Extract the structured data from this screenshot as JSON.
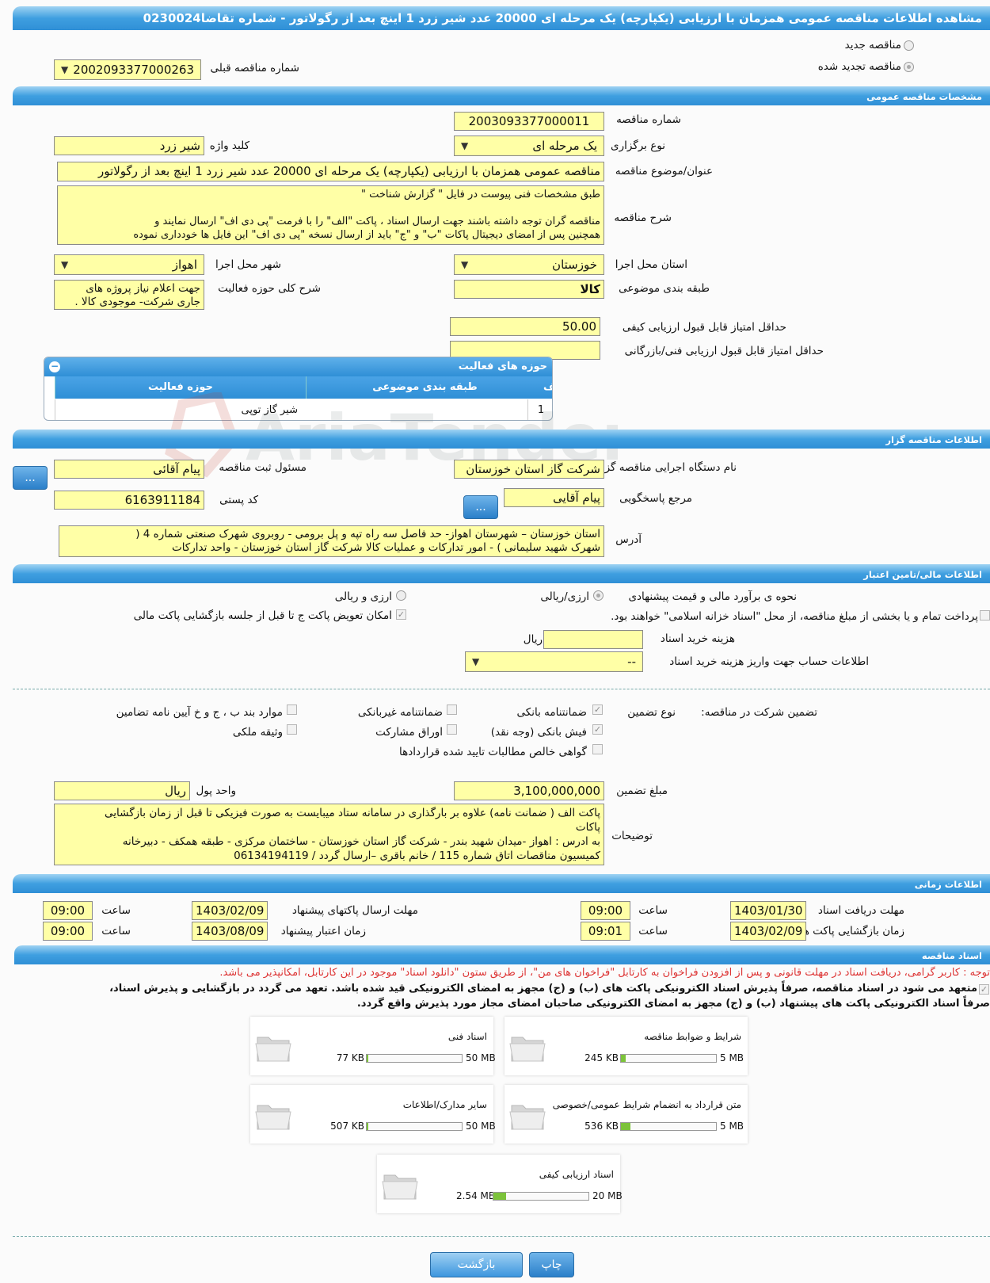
{
  "page_title": "مشاهده اطلاعات مناقصه عمومی همزمان با ارزیابی (یکپارچه) یک مرحله ای 20000 عدد شیر زرد 1 اینچ بعد از رگولاتور - شماره تقاضا0230024",
  "tender_type": {
    "new_label": "مناقصه جدید",
    "renewed_label": "مناقصه تجدید شده",
    "selected": "renewed",
    "prev_label": "شماره مناقصه قبلی",
    "prev_value": "2002093377000263"
  },
  "general": {
    "section_title": "مشخصات مناقصه عمومی",
    "number_label": "شماره مناقصه",
    "number": "2003093377000011",
    "method_label": "نوع برگزاری",
    "method": "یک مرحله ای",
    "keyword_label": "کلید واژه",
    "keyword": "شیر زرد",
    "subject_label": "عنوان/موضوع مناقصه",
    "subject": "مناقصه عمومی همزمان با ارزیابی (یکپارچه) یک مرحله ای 20000 عدد شیر زرد 1 اینچ بعد از رگولاتور",
    "desc_label": "شرح مناقصه",
    "desc_lines": [
      "طبق مشخصات فنی پیوست در فایل  \" گزارش شناخت \"",
      "",
      "مناقصه گران توجه داشته باشند جهت ارسال اسناد ، پاکت \"الف\" را با فرمت  \"پی دی اف\"  ارسال نمایند و",
      "همچنین پس از امضای دیجیتال پاکات  \"ب\" و \"ج\" باید از ارسال نسخه \"پی دی اف\"  این فایل ها خودداری نموده"
    ],
    "province_label": "استان محل اجرا",
    "province": "خوزستان",
    "city_label": "شهر محل اجرا",
    "city": "اهواز",
    "category_label": "طبقه بندی موضوعی",
    "category": "کالا",
    "activity_desc_label": "شرح کلی حوزه فعالیت",
    "activity_desc_lines": [
      "جهت اعلام نیاز پروژه های",
      "جاری شرکت- موجودی کالا ."
    ],
    "min_quality_label": "حداقل امتیاز قابل قبول ارزیابی کیفی",
    "min_quality": "50.00",
    "min_tech_label": "حداقل امتیاز قابل قبول ارزیابی فنی/بازرگانی",
    "min_tech": "",
    "activity_grid": {
      "title": "حوزه های فعالیت",
      "columns": [
        "ردیف",
        "طبقه بندی موضوعی",
        "حوزه فعالیت"
      ],
      "rows": [
        {
          "row": "1",
          "category": "شیر گاز توپی",
          "field": ""
        }
      ]
    }
  },
  "organizer": {
    "section_title": "اطلاعات مناقصه گزار",
    "org_label": "نام دستگاه اجرایی مناقصه گزار",
    "org": "شرکت گاز استان خوزستان",
    "registrar_label": "مسئول ثبت مناقصه",
    "registrar": "پیام  آقائی",
    "responder_label": "مرجع پاسخگویی",
    "responder": "پیام آقایی",
    "postal_label": "کد پستی",
    "postal": "6163911184",
    "address_label": "آدرس",
    "address_lines": [
      "استان خوزستان – شهرستان اهواز- حد فاصل سه راه تپه  و پل برومی - روبروی شهرک صنعتی شماره 4 (",
      "شهرک شهید سلیمانی  ) - امور تدارکات و عملیات کالا شرکت گاز استان خوزستان - واحد تدارکات"
    ],
    "more_btn": "..."
  },
  "finance": {
    "section_title": "اطلاعات مالی/تامین اعتبار",
    "estimate_label": "نحوه ی برآورد مالی و قیمت پیشنهادی",
    "opt_rial": "ارزی/ریالی",
    "opt_fx": "ارزی و ریالی",
    "treasury_label": "پرداخت تمام و یا بخشی از مبلغ مناقصه، از محل \"اسناد خزانه اسلامی\" خواهند بود.",
    "swap_label": "امکان تعویض پاکت ج تا قبل از جلسه بازگشایی پاکت مالی",
    "doc_cost_label": "هزینه خرید اسناد",
    "doc_cost": "",
    "doc_cost_unit": "ریال",
    "account_label": "اطلاعات حساب جهت واریز هزینه خرید اسناد",
    "account": "--",
    "guarantee_label": "تضمین شرکت در مناقصه:",
    "guarantee_type_label": "نوع تضمین",
    "g_bank": "ضمانتنامه بانکی",
    "g_nonbank": "ضمانتنامه غیربانکی",
    "g_items": "موارد بند ب ، ج و خ آیین نامه تضامین",
    "g_cash": "فیش بانکی (وجه نقد)",
    "g_bonds": "اوراق مشارکت",
    "g_property": "وثیقه ملکی",
    "g_claims": "گواهی خالص مطالبات تایید شده قراردادها",
    "amount_label": "مبلغ تضمین",
    "amount": "3,100,000,000",
    "currency_label": "واحد پول",
    "currency": "ریال",
    "notes_label": "توضیحات",
    "notes_lines": [
      "پاکت الف ( ضمانت نامه) علاوه بر بارگذاری در سامانه ستاد میبایست به صورت فیزیکی تا قبل از زمان بازگشایی",
      "پاکات",
      "به ادرس : اهواز -میدان شهید بندر - شرکت گاز استان خوزستان - ساختمان مرکزی - طبقه همکف - دبیرخانه",
      "کمیسیون مناقصات اتاق شماره 115 / خانم باقری –ارسال گردد / 06134194119"
    ]
  },
  "timing": {
    "section_title": "اطلاعات زمانی",
    "receive_label": "مهلت دریافت اسناد",
    "receive_date": "1403/01/30",
    "receive_time": "09:00",
    "submit_label": "مهلت ارسال پاکتهای پیشنهاد",
    "submit_date": "1403/02/09",
    "submit_time": "09:00",
    "open_label": "زمان بازگشایی پاکت ها",
    "open_date": "1403/02/09",
    "open_time": "09:01",
    "validity_label": "زمان اعتبار پیشنهاد",
    "validity_date": "1403/08/09",
    "validity_time": "09:00",
    "time_label": "ساعت"
  },
  "documents": {
    "section_title": "اسناد مناقصه",
    "notice": "توجه : کاربر گرامی، دریافت اسناد در مهلت قانونی و پس از افزودن فراخوان به کارتابل \"فراخوان های من\"، از طریق ستون \"دانلود اسناد\" موجود در این کارتابل، امکانپذیر می باشد.",
    "commit_lines": [
      "متعهد می شود در اسناد مناقصه، صرفاً پذیرش اسناد الکترونیکی پاکت های (ب) و (ج) مجهز به امضای الکترونیکی قید شده باشد. تعهد می گردد در بازگشایی و پذیرش اسناد،",
      "صرفاً اسناد الکترونیکی پاکت های پیشنهاد (ب) و (ج) مجهز به امضای الکترونیکی صاحبان امضای مجاز مورد پذیرش واقع گردد."
    ],
    "cards": [
      {
        "title": "شرایط و ضوابط مناقصه",
        "size": "245 KB",
        "max": "5 MB",
        "fill": 0.05
      },
      {
        "title": "اسناد فنی",
        "size": "77 KB",
        "max": "50 MB",
        "fill": 0.01
      },
      {
        "title": "متن قرارداد به انضمام شرایط عمومی/خصوصی",
        "size": "536 KB",
        "max": "5 MB",
        "fill": 0.1
      },
      {
        "title": "سایر مدارک/اطلاعات",
        "size": "507 KB",
        "max": "50 MB",
        "fill": 0.01
      },
      {
        "title": "اسناد ارزیابی کیفی",
        "size": "2.54 MB",
        "max": "20 MB",
        "fill": 0.13
      }
    ]
  },
  "buttons": {
    "print": "چاپ",
    "back": "بازگشت"
  },
  "watermark": "AriaTender.neT"
}
